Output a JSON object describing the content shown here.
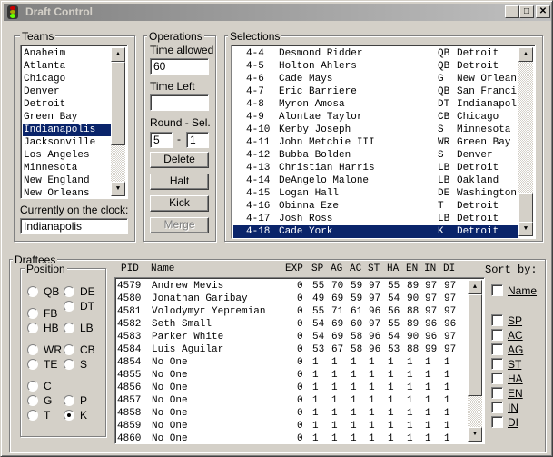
{
  "window": {
    "title": "Draft Control",
    "minimize": "_",
    "maximize": "□",
    "close": "✕",
    "icon": "traffic-light-icon"
  },
  "teams": {
    "label": "Teams",
    "items": [
      "Anaheim",
      "Atlanta",
      "Chicago",
      "Denver",
      "Detroit",
      "Green Bay",
      "Indianapolis",
      "Jacksonville",
      "Los Angeles",
      "Minnesota",
      "New England",
      "New Orleans"
    ],
    "selected": "Indianapolis",
    "on_clock_label": "Currently on the clock:",
    "on_clock_value": "Indianapolis"
  },
  "operations": {
    "label": "Operations",
    "time_allowed_label": "Time allowed",
    "time_allowed": "60",
    "time_left_label": "Time Left",
    "time_left": "",
    "round_sel_label": "Round - Sel.",
    "round": "5",
    "sep": "-",
    "sel": "1",
    "delete": "Delete",
    "halt": "Halt",
    "kick": "Kick",
    "merge": "Merge"
  },
  "selections": {
    "label": "Selections",
    "selected_index": 14,
    "rows": [
      [
        "4-4",
        "Desmond Ridder",
        "QB",
        "Detroit"
      ],
      [
        "4-5",
        "Holton Ahlers",
        "QB",
        "Detroit"
      ],
      [
        "4-6",
        "Cade Mays",
        "G",
        "New Orlean"
      ],
      [
        "4-7",
        "Eric Barriere",
        "QB",
        "San Franci"
      ],
      [
        "4-8",
        "Myron Amosa",
        "DT",
        "Indianapol"
      ],
      [
        "4-9",
        "Alontae Taylor",
        "CB",
        "Chicago"
      ],
      [
        "4-10",
        "Kerby Joseph",
        "S",
        "Minnesota"
      ],
      [
        "4-11",
        "John Metchie III",
        "WR",
        "Green Bay"
      ],
      [
        "4-12",
        "Bubba Bolden",
        "S",
        "Denver"
      ],
      [
        "4-13",
        "Christian Harris",
        "LB",
        "Detroit"
      ],
      [
        "4-14",
        "DeAngelo Malone",
        "LB",
        "Oakland"
      ],
      [
        "4-15",
        "Logan Hall",
        "DE",
        "Washington"
      ],
      [
        "4-16",
        "Obinna Eze",
        "T",
        "Detroit"
      ],
      [
        "4-17",
        "Josh Ross",
        "LB",
        "Detroit"
      ],
      [
        "4-18",
        "Cade York",
        "K",
        "Detroit"
      ]
    ]
  },
  "draftees": {
    "label": "Draftees",
    "position_label": "Position",
    "positions": [
      {
        "label": "QB",
        "checked": false
      },
      {
        "label": "DE",
        "checked": false
      },
      {
        "label": "DT",
        "checked": false
      },
      {
        "label": "FB",
        "checked": false
      },
      {
        "label": "HB",
        "checked": false
      },
      {
        "label": "LB",
        "checked": false
      },
      {
        "label": "WR",
        "checked": false
      },
      {
        "label": "CB",
        "checked": false
      },
      {
        "label": "TE",
        "checked": false
      },
      {
        "label": "S",
        "checked": false
      },
      {
        "label": "C",
        "checked": false
      },
      {
        "label": "G",
        "checked": false
      },
      {
        "label": "P",
        "checked": false
      },
      {
        "label": "T",
        "checked": false
      },
      {
        "label": "K",
        "checked": true
      }
    ],
    "columns": [
      "PID",
      "Name",
      "EXP",
      "SP",
      "AG",
      "AC",
      "ST",
      "HA",
      "EN",
      "IN",
      "DI"
    ],
    "rows": [
      [
        "4579",
        "Andrew Mevis",
        "0",
        "55",
        "70",
        "59",
        "97",
        "55",
        "89",
        "97",
        "97"
      ],
      [
        "4580",
        "Jonathan Garibay",
        "0",
        "49",
        "69",
        "59",
        "97",
        "54",
        "90",
        "97",
        "97"
      ],
      [
        "4581",
        "Volodymyr Yepremian",
        "0",
        "55",
        "71",
        "61",
        "96",
        "56",
        "88",
        "97",
        "97"
      ],
      [
        "4582",
        "Seth Small",
        "0",
        "54",
        "69",
        "60",
        "97",
        "55",
        "89",
        "96",
        "96"
      ],
      [
        "4583",
        "Parker White",
        "0",
        "54",
        "69",
        "58",
        "96",
        "54",
        "90",
        "96",
        "97"
      ],
      [
        "4584",
        "Luis Aguilar",
        "0",
        "53",
        "67",
        "58",
        "96",
        "53",
        "88",
        "99",
        "97"
      ],
      [
        "4854",
        "No One",
        "0",
        "1",
        "1",
        "1",
        "1",
        "1",
        "1",
        "1",
        "1"
      ],
      [
        "4855",
        "No One",
        "0",
        "1",
        "1",
        "1",
        "1",
        "1",
        "1",
        "1",
        "1"
      ],
      [
        "4856",
        "No One",
        "0",
        "1",
        "1",
        "1",
        "1",
        "1",
        "1",
        "1",
        "1"
      ],
      [
        "4857",
        "No One",
        "0",
        "1",
        "1",
        "1",
        "1",
        "1",
        "1",
        "1",
        "1"
      ],
      [
        "4858",
        "No One",
        "0",
        "1",
        "1",
        "1",
        "1",
        "1",
        "1",
        "1",
        "1"
      ],
      [
        "4859",
        "No One",
        "0",
        "1",
        "1",
        "1",
        "1",
        "1",
        "1",
        "1",
        "1"
      ],
      [
        "4860",
        "No One",
        "0",
        "1",
        "1",
        "1",
        "1",
        "1",
        "1",
        "1",
        "1"
      ]
    ],
    "sort_label": "Sort by:",
    "sort_name": {
      "label": "Name",
      "checked": false
    },
    "sort_options": [
      {
        "label": "SP",
        "checked": false
      },
      {
        "label": "AC",
        "checked": false
      },
      {
        "label": "AG",
        "checked": false
      },
      {
        "label": "ST",
        "checked": false
      },
      {
        "label": "HA",
        "checked": false
      },
      {
        "label": "EN",
        "checked": false
      },
      {
        "label": "IN",
        "checked": false
      },
      {
        "label": "DI",
        "checked": false
      }
    ]
  }
}
